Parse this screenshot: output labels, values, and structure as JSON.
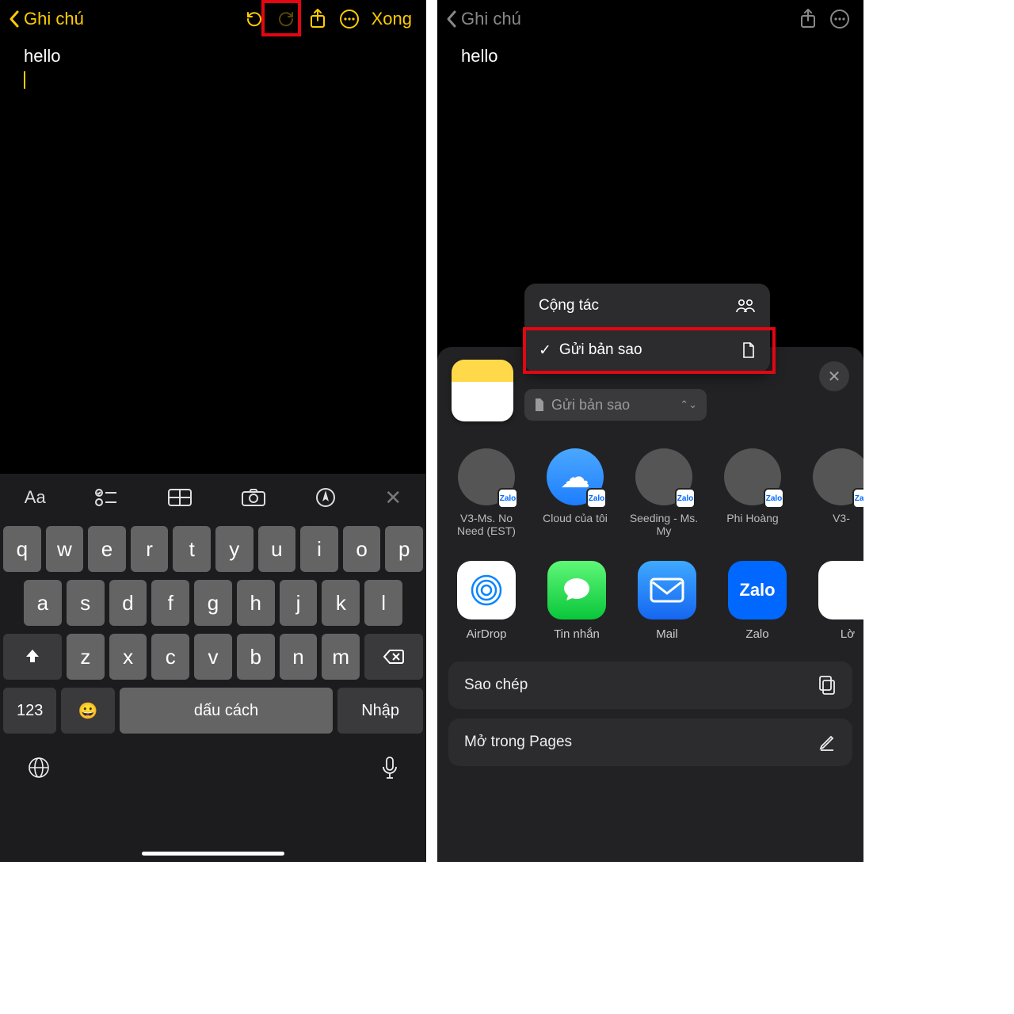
{
  "left": {
    "back_label": "Ghi chú",
    "done_label": "Xong",
    "note_text": "hello",
    "toolbar": {
      "aa": "Aa"
    },
    "keys": {
      "r1": [
        "q",
        "w",
        "e",
        "r",
        "t",
        "y",
        "u",
        "i",
        "o",
        "p"
      ],
      "r2": [
        "a",
        "s",
        "d",
        "f",
        "g",
        "h",
        "j",
        "k",
        "l"
      ],
      "r3": [
        "z",
        "x",
        "c",
        "v",
        "b",
        "n",
        "m"
      ],
      "num": "123",
      "space": "dấu cách",
      "enter": "Nhập"
    }
  },
  "right": {
    "back_label": "Ghi chú",
    "note_text": "hello",
    "popover": {
      "opt1": "Cộng tác",
      "opt2": "Gửi bản sao"
    },
    "dropdown": "Gửi bản sao",
    "contacts": [
      {
        "name": "V3-Ms. No Need (EST)",
        "badge": "Zalo"
      },
      {
        "name": "Cloud của tôi",
        "badge": "Zalo",
        "cloud": true
      },
      {
        "name": "Seeding - Ms. My",
        "badge": "Zalo"
      },
      {
        "name": "Phi Hoàng",
        "badge": "Zalo"
      },
      {
        "name": "V3-",
        "badge": "Zalo"
      }
    ],
    "apps": [
      {
        "name": "AirDrop",
        "bg": "#fff",
        "fg": "#0a84ff",
        "sym": "◎"
      },
      {
        "name": "Tin nhắn",
        "bg": "linear-gradient(#5ff777,#09c63a)",
        "sym": "●"
      },
      {
        "name": "Mail",
        "bg": "linear-gradient(#3fa9ff,#1566f1)",
        "sym": "✉"
      },
      {
        "name": "Zalo",
        "bg": "#0068ff",
        "sym": "Zalo"
      },
      {
        "name": "Lờ",
        "bg": "#fff",
        "sym": "⋮"
      }
    ],
    "actions": [
      {
        "label": "Sao chép",
        "icon": "copy"
      },
      {
        "label": "Mở trong Pages",
        "icon": "edit"
      }
    ]
  }
}
